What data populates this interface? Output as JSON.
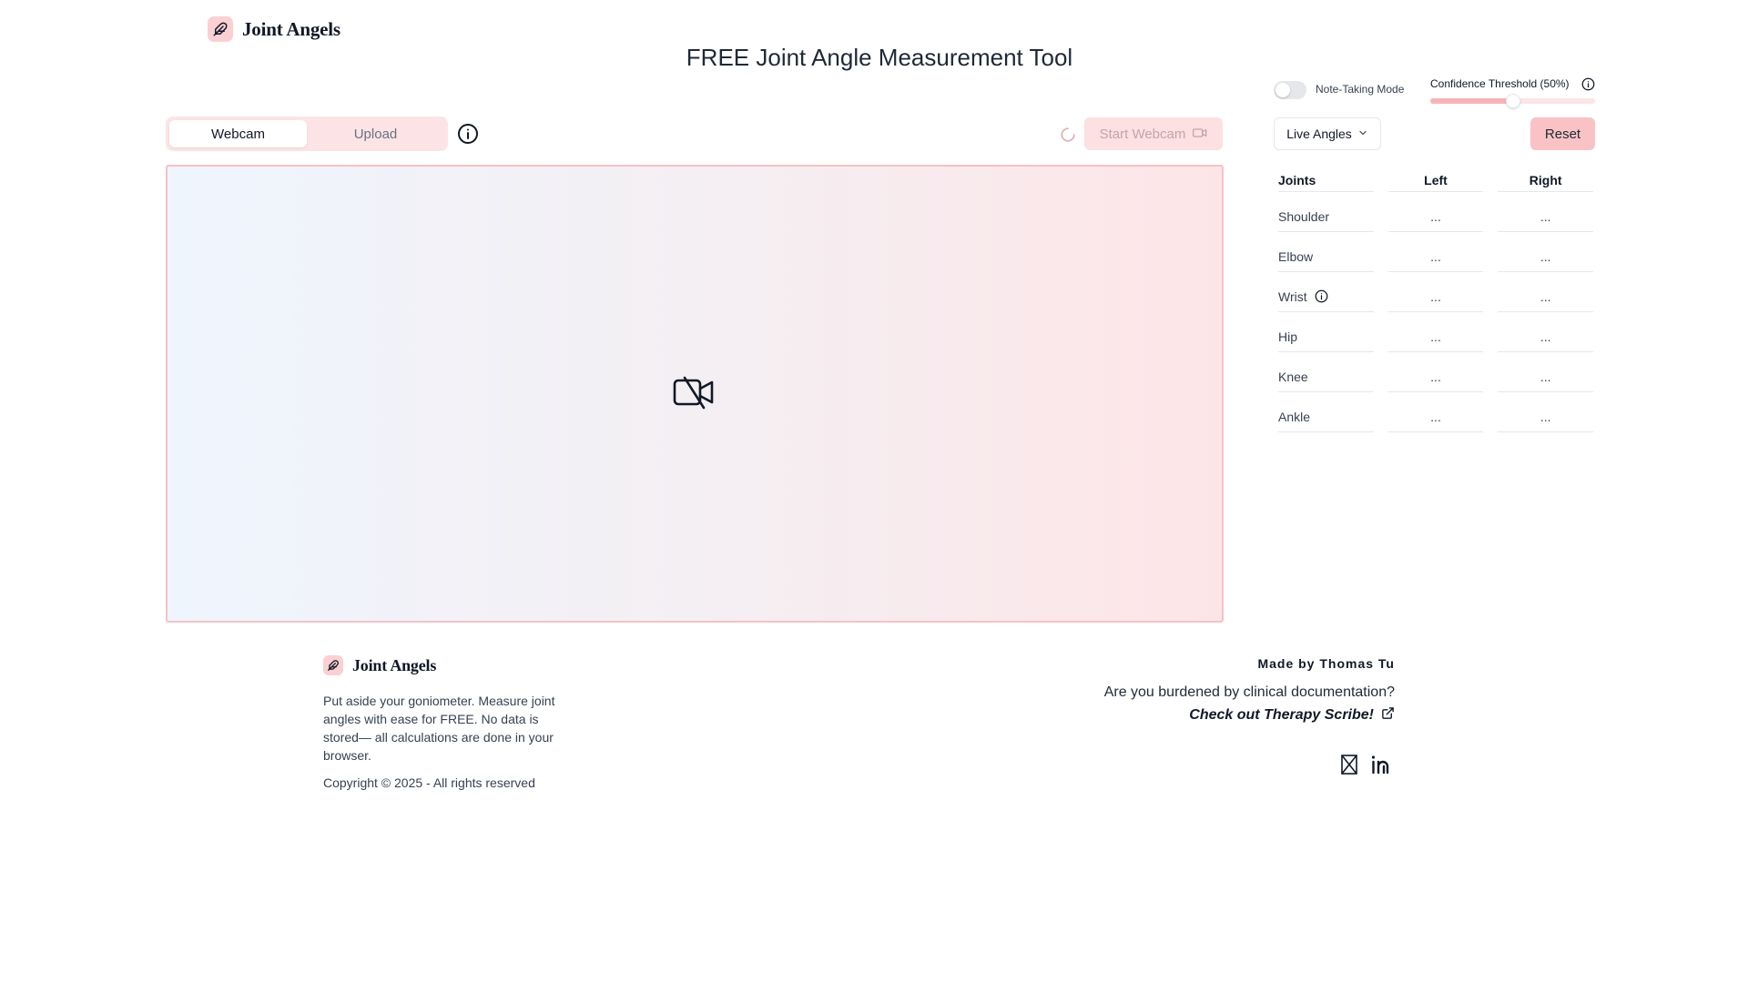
{
  "brand": {
    "name": "Joint Angels"
  },
  "page": {
    "title": "FREE Joint Angle Measurement Tool"
  },
  "tabs": [
    {
      "label": "Webcam",
      "active": true
    },
    {
      "label": "Upload",
      "active": false
    }
  ],
  "controls": {
    "start_webcam_label": "Start Webcam",
    "note_taking_label": "Note-Taking Mode",
    "note_taking_enabled": false,
    "confidence_label": "Confidence Threshold (50%)",
    "confidence_value": 0.5,
    "view_select_value": "Live Angles",
    "reset_label": "Reset"
  },
  "angles_table": {
    "headers": [
      "Joints",
      "Left",
      "Right"
    ],
    "rows": [
      {
        "joint": "Shoulder",
        "left": "...",
        "right": "..."
      },
      {
        "joint": "Elbow",
        "left": "...",
        "right": "..."
      },
      {
        "joint": "Wrist",
        "left": "...",
        "right": "..."
      },
      {
        "joint": "Hip",
        "left": "...",
        "right": "..."
      },
      {
        "joint": "Knee",
        "left": "...",
        "right": "..."
      },
      {
        "joint": "Ankle",
        "left": "...",
        "right": "..."
      }
    ]
  },
  "footer": {
    "brand": "Joint Angels",
    "description": "Put aside your goniometer. Measure joint angles with ease for FREE. No data is stored— all calculations are done in your browser.",
    "copyright": "Copyright © 2025 - All rights reserved",
    "made_by": "Made by Thomas Tu",
    "burden_text": "Are you burdened by clinical documentation?",
    "scribe_link": "Check out Therapy Scribe!"
  },
  "colors": {
    "accent": "#f9c2c5",
    "accent_light": "#fde0e2",
    "video_border": "#f6c1c4"
  },
  "icons": [
    "feather-logo-icon",
    "info-icon",
    "spinner-icon",
    "video-camera-icon",
    "video-off-icon",
    "chevron-down-icon",
    "external-link-icon",
    "x-logo-icon",
    "linkedin-icon"
  ]
}
